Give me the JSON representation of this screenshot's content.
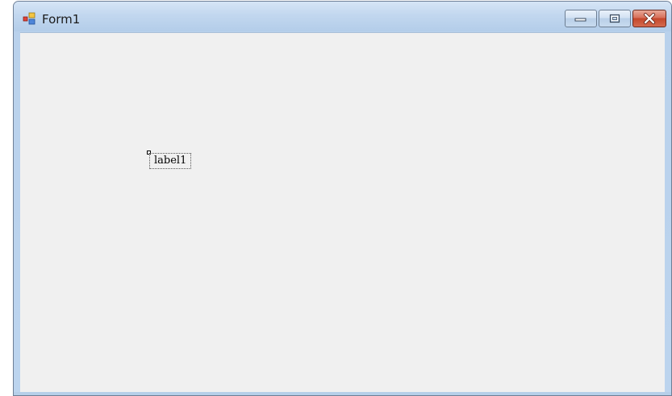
{
  "window": {
    "title": "Form1",
    "caption_buttons": {
      "minimize_icon": "minimize-icon",
      "maximize_icon": "maximize-icon",
      "close_icon": "close-icon"
    }
  },
  "form": {
    "background": "#f0f0f0",
    "controls": [
      {
        "type": "label",
        "text": "label1"
      }
    ]
  },
  "colors": {
    "titlebar": "#c2d7ef",
    "close_button": "#c4472b"
  }
}
